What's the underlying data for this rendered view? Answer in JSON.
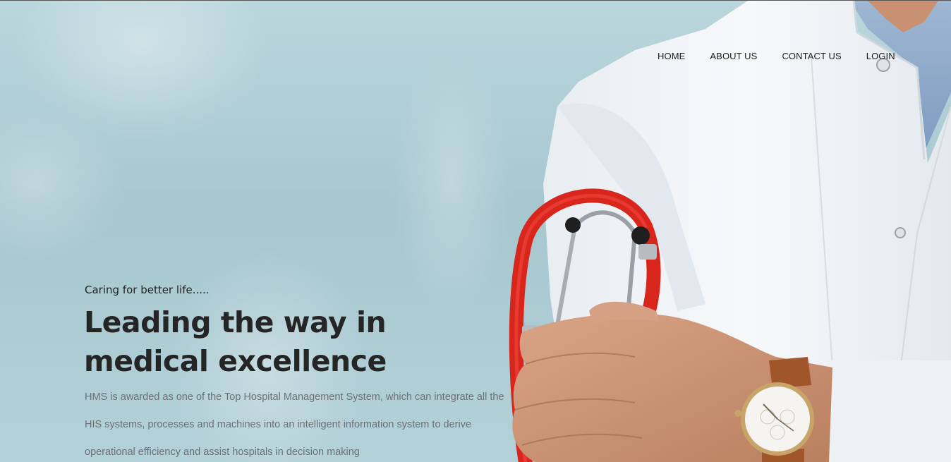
{
  "nav": {
    "items": [
      {
        "label": "HOME"
      },
      {
        "label": "ABOUT US"
      },
      {
        "label": "CONTACT US"
      },
      {
        "label": "LOGIN"
      }
    ]
  },
  "hero": {
    "tagline": "Caring for better life.....",
    "headline": "Leading the way in medical excellence",
    "description": "HMS is awarded as one of the Top Hospital Management System, which can integrate all the HIS systems, processes and machines into an intelligent information system to derive operational efficiency and assist hospitals in decision making"
  },
  "colors": {
    "background": "#a9c9d0",
    "coat": "#f2f4f7",
    "stethoscope": "#e0261c",
    "headline": "#252525",
    "body_text": "#6b7073"
  }
}
